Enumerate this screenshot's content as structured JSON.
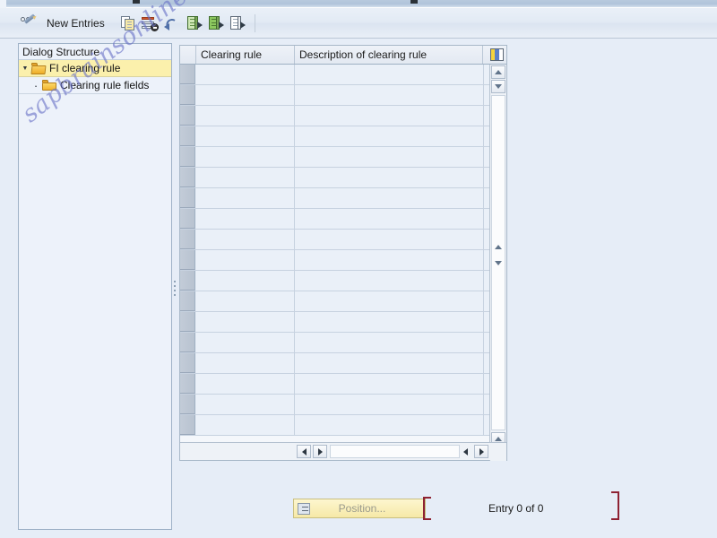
{
  "window": {
    "title_strip_visible": true
  },
  "toolbar": {
    "items": [
      {
        "name": "display-change-toggle",
        "icon": "display-change-icon",
        "label": ""
      },
      {
        "name": "new-entries-button",
        "icon": "",
        "label": "New Entries"
      },
      {
        "name": "copy-as-button",
        "icon": "copy-icon",
        "label": ""
      },
      {
        "name": "delete-button",
        "icon": "delete-row-icon",
        "label": ""
      },
      {
        "name": "undo-button",
        "icon": "undo-icon",
        "label": ""
      },
      {
        "name": "select-all-button",
        "icon": "page-arrow-green-icon",
        "label": ""
      },
      {
        "name": "select-block-button",
        "icon": "page-arrow-greenfill-icon",
        "label": ""
      },
      {
        "name": "deselect-all-button",
        "icon": "page-arrow-plain-icon",
        "label": ""
      }
    ],
    "new_entries_label": "New Entries"
  },
  "tree": {
    "header": "Dialog Structure",
    "items": [
      {
        "label": "FI clearing rule",
        "selected": true,
        "expanded": true,
        "level": 0
      },
      {
        "label": "Clearing rule fields",
        "selected": false,
        "expanded": false,
        "level": 1
      }
    ]
  },
  "table": {
    "columns": [
      {
        "key": "clearing_rule",
        "header": "Clearing rule"
      },
      {
        "key": "description",
        "header": "Description of clearing rule"
      }
    ],
    "rows": [],
    "empty_row_count": 18,
    "config_icon": "table-settings-icon"
  },
  "footer": {
    "position_button_label": "Position...",
    "position_button_enabled": false,
    "entry_counter": "Entry 0 of 0"
  },
  "watermark": {
    "text": "sapbrainsonline.com"
  },
  "colors": {
    "background": "#e6edf7",
    "tree_selected": "#fbf0ac",
    "table_row": "#eaf0f8",
    "accent_red_bracket": "#8e2233",
    "folder_yellow": "#f2b52e"
  }
}
